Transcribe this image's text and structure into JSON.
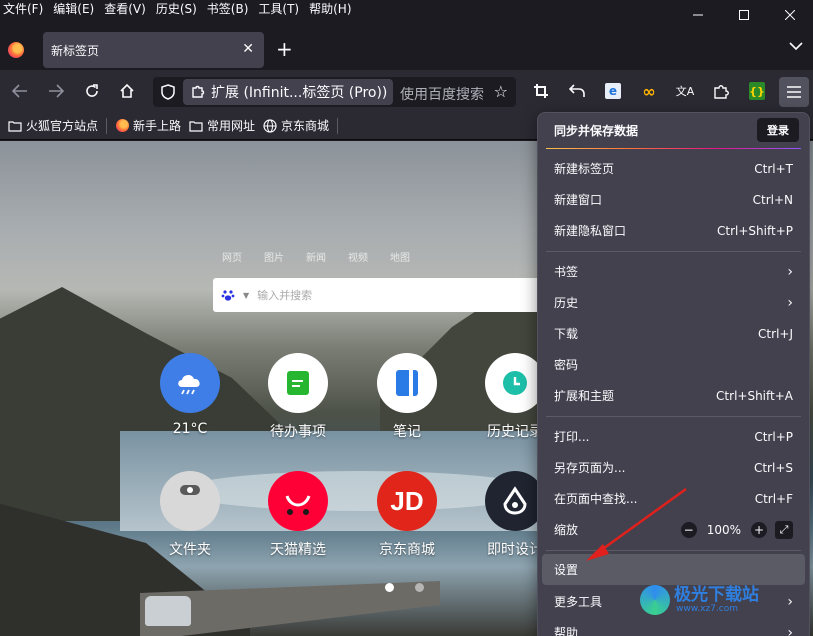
{
  "menubar": {
    "items": [
      "文件(F)",
      "编辑(E)",
      "查看(V)",
      "历史(S)",
      "书签(B)",
      "工具(T)",
      "帮助(H)"
    ]
  },
  "tab": {
    "title": "新标签页"
  },
  "urlbar": {
    "extension_label": "扩展 (Infinit...标签页 (Pro))",
    "search_placeholder": "使用百度搜索"
  },
  "bookmarks": [
    {
      "label": "火狐官方站点",
      "icon": "folder-icon"
    },
    {
      "label": "新手上路",
      "icon": "firefox-icon"
    },
    {
      "label": "常用网址",
      "icon": "folder-icon"
    },
    {
      "label": "京东商城",
      "icon": "globe-icon"
    }
  ],
  "newtab": {
    "search_tabs": [
      "网页",
      "图片",
      "新闻",
      "视频",
      "地图"
    ],
    "search_placeholder": "输入并搜索",
    "apps": [
      {
        "label": "21°C",
        "icon": "weather-icon",
        "color": "#3f7ee6"
      },
      {
        "label": "待办事项",
        "icon": "todo-icon",
        "color": "#ffffff"
      },
      {
        "label": "笔记",
        "icon": "notes-icon",
        "color": "#ffffff"
      },
      {
        "label": "历史记录",
        "icon": "clock-icon",
        "color": "#ffffff"
      },
      {
        "label": "文件夹",
        "icon": "folder-icon",
        "color": "#d8d8d8"
      },
      {
        "label": "天猫精选",
        "icon": "tmall-icon",
        "color": "#ff0036"
      },
      {
        "label": "京东商城",
        "icon": "jd-icon",
        "color": "#e1251b"
      },
      {
        "label": "即时设计",
        "icon": "design-icon",
        "color": "#1f2430"
      }
    ],
    "jd_text": "JD"
  },
  "menu": {
    "sync_title": "同步并保存数据",
    "login_label": "登录",
    "items": [
      {
        "label": "新建标签页",
        "shortcut": "Ctrl+T"
      },
      {
        "label": "新建窗口",
        "shortcut": "Ctrl+N"
      },
      {
        "label": "新建隐私窗口",
        "shortcut": "Ctrl+Shift+P"
      },
      {
        "label": "书签",
        "shortcut": ""
      },
      {
        "label": "历史",
        "shortcut": ""
      },
      {
        "label": "下载",
        "shortcut": "Ctrl+J"
      },
      {
        "label": "密码",
        "shortcut": ""
      },
      {
        "label": "扩展和主题",
        "shortcut": "Ctrl+Shift+A"
      },
      {
        "label": "打印...",
        "shortcut": "Ctrl+P"
      },
      {
        "label": "另存页面为...",
        "shortcut": "Ctrl+S"
      },
      {
        "label": "在页面中查找...",
        "shortcut": "Ctrl+F"
      },
      {
        "label": "缩放",
        "shortcut": ""
      },
      {
        "label": "设置",
        "shortcut": ""
      },
      {
        "label": "更多工具",
        "shortcut": ""
      },
      {
        "label": "帮助",
        "shortcut": ""
      }
    ],
    "zoom": {
      "minus": "−",
      "value": "100%",
      "plus": "+"
    }
  },
  "watermark": {
    "title": "极光下载站",
    "url": "www.xz7.com"
  },
  "colors": {
    "accent_arrow": "#e0201c",
    "panel_bg": "#42414d",
    "toolbar_bg": "#2b2a33"
  }
}
